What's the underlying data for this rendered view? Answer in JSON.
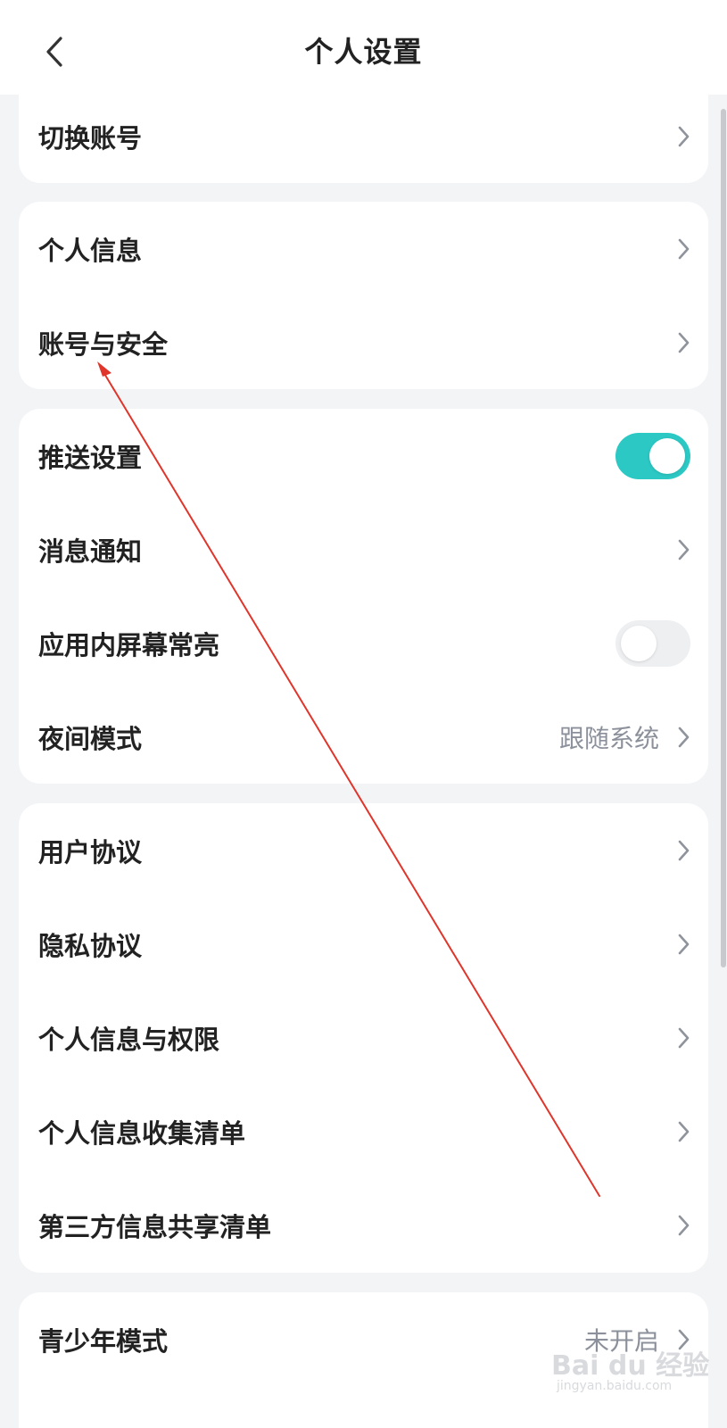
{
  "header": {
    "title": "个人设置",
    "back_icon": "chevron-left-icon"
  },
  "groups": [
    {
      "items": [
        {
          "label": "切换账号",
          "control": "chevron"
        }
      ]
    },
    {
      "items": [
        {
          "label": "个人信息",
          "control": "chevron"
        },
        {
          "label": "账号与安全",
          "control": "chevron"
        }
      ]
    },
    {
      "items": [
        {
          "label": "推送设置",
          "control": "toggle",
          "on": true
        },
        {
          "label": "消息通知",
          "control": "chevron"
        },
        {
          "label": "应用内屏幕常亮",
          "control": "toggle",
          "on": false
        },
        {
          "label": "夜间模式",
          "control": "chevron",
          "value": "跟随系统"
        }
      ]
    },
    {
      "items": [
        {
          "label": "用户协议",
          "control": "chevron"
        },
        {
          "label": "隐私协议",
          "control": "chevron"
        },
        {
          "label": "个人信息与权限",
          "control": "chevron"
        },
        {
          "label": "个人信息收集清单",
          "control": "chevron"
        },
        {
          "label": "第三方信息共享清单",
          "control": "chevron"
        }
      ]
    },
    {
      "items": [
        {
          "label": "青少年模式",
          "control": "chevron",
          "value": "未开启"
        }
      ]
    }
  ],
  "colors": {
    "accent": "#2cc8c4",
    "background": "#f3f4f6",
    "card": "#ffffff",
    "text": "#222222",
    "secondary_text": "#8b909a",
    "chevron": "#8e939c",
    "annotation_arrow": "#e0352b"
  },
  "watermark": {
    "brand": "Bai du 经验",
    "url": "jingyan.baidu.com"
  }
}
